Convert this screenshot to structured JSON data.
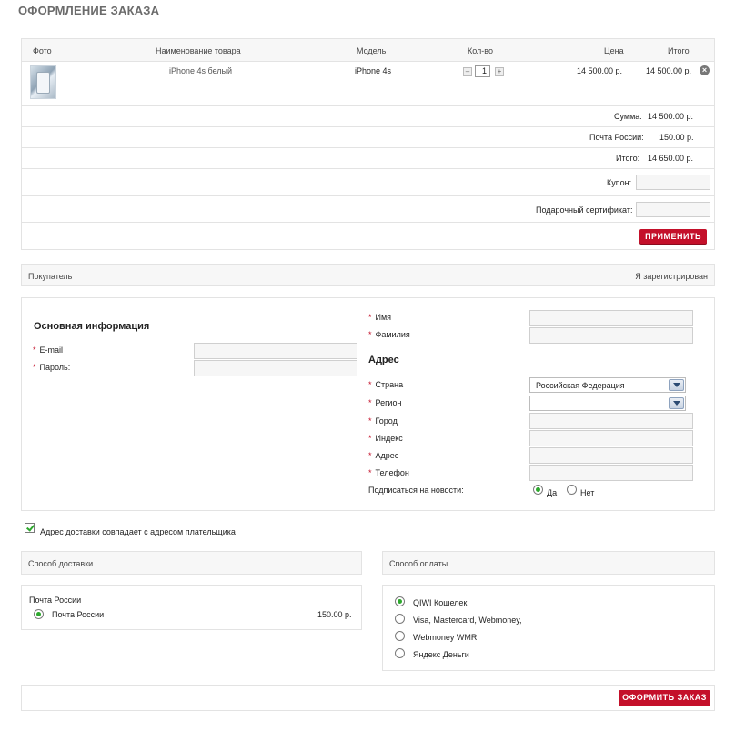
{
  "page_title": "ОФОРМЛЕНИЕ ЗАКАЗА",
  "cart": {
    "headers": {
      "photo": "Фото",
      "name": "Наименование товара",
      "model": "Модель",
      "qty": "Кол-во",
      "price": "Цена",
      "total": "Итого"
    },
    "item": {
      "name": "iPhone 4s белый",
      "model": "iPhone 4s",
      "qty": "1",
      "price": "14 500.00 р.",
      "total": "14 500.00 р."
    },
    "summary": {
      "sum_label": "Сумма:",
      "sum_value": "14 500.00 р.",
      "post_label": "Почта России:",
      "post_value": "150.00 р.",
      "total_label": "Итого:",
      "total_value": "14 650.00 р.",
      "coupon_label": "Купон:",
      "cert_label": "Подарочный сертификат:",
      "apply_button": "ПРИМЕНИТЬ"
    }
  },
  "buyer": {
    "label": "Покупатель",
    "registered": "Я зарегистрирован"
  },
  "main_info": {
    "title": "Основная информация",
    "email": "E-mail",
    "password": "Пароль:"
  },
  "personal": {
    "first_name": "Имя",
    "last_name": "Фамилия"
  },
  "address": {
    "title": "Адрес",
    "country": "Страна",
    "country_value": "Российская Федерация",
    "region": "Регион",
    "city": "Город",
    "zip": "Индекс",
    "street": "Адрес",
    "phone": "Телефон",
    "newsletter": "Подписаться на новости:",
    "yes": "Да",
    "no": "Нет"
  },
  "same_address": "Адрес доставки совпадает с адресом плательщика",
  "delivery": {
    "title": "Способ доставки",
    "group": "Почта России",
    "option": "Почта России",
    "price": "150.00 р."
  },
  "payment": {
    "title": "Способ оплаты",
    "options": [
      "QIWI Кошелек",
      "Visa, Mastercard, Webmoney,",
      "Webmoney WMR",
      "Яндекс Деньги"
    ]
  },
  "submit_button": "ОФОРМИТЬ ЗАКАЗ"
}
